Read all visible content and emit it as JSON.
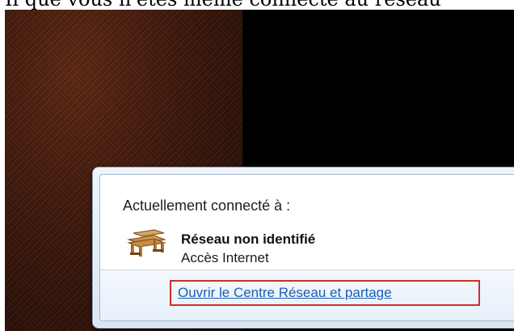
{
  "top_text": "Il que vous n'êtes même connecté au réseau",
  "network_popup": {
    "header_label": "Actuellement connecté à :",
    "network": {
      "name": "Réseau non identifié",
      "access": "Accès Internet",
      "icon": "bench-icon"
    },
    "link_label": "Ouvrir le Centre Réseau et partage"
  },
  "colors": {
    "link": "#1c5eb3",
    "highlight_border": "#d22c2c",
    "background": "#000000",
    "wallpaper": "#4b1f0e"
  }
}
